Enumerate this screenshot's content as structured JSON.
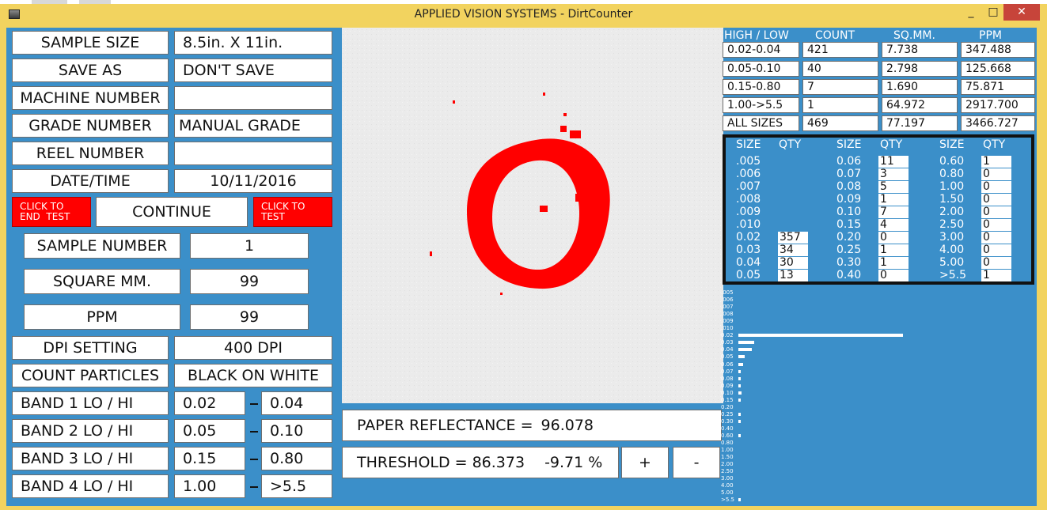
{
  "window": {
    "title": "APPLIED VISION SYSTEMS - DirtCounter",
    "minimize": "_",
    "maximize": "□",
    "close": "✕"
  },
  "icons": {
    "app": "app-icon"
  },
  "fields": {
    "sample_size": {
      "label": "SAMPLE SIZE",
      "value": "8.5in. X 11in."
    },
    "save_as": {
      "label": "SAVE AS",
      "value": "DON'T SAVE"
    },
    "machine_number": {
      "label": "MACHINE NUMBER",
      "value": ""
    },
    "grade_number": {
      "label": "GRADE NUMBER",
      "value": "MANUAL GRADE"
    },
    "reel_number": {
      "label": "REEL NUMBER",
      "value": ""
    },
    "date_time": {
      "label": "DATE/TIME",
      "value": "10/11/2016"
    }
  },
  "buttons": {
    "end_test": "CLICK TO\nEND  TEST",
    "continue": "CONTINUE",
    "test": "CLICK TO\nTEST"
  },
  "results": {
    "sample_number": {
      "label": "SAMPLE NUMBER",
      "value": "1"
    },
    "square_mm": {
      "label": "SQUARE MM.",
      "value": "99"
    },
    "ppm": {
      "label": "PPM",
      "value": "99"
    }
  },
  "settings": {
    "dpi": {
      "label": "DPI SETTING",
      "value": "400 DPI"
    },
    "count_particles": {
      "label": "COUNT PARTICLES",
      "value": "BLACK ON WHITE"
    }
  },
  "bands": [
    {
      "label": "BAND 1 LO / HI",
      "lo": "0.02",
      "hi": "0.04"
    },
    {
      "label": "BAND 2 LO / HI",
      "lo": "0.05",
      "hi": "0.10"
    },
    {
      "label": "BAND 3 LO / HI",
      "lo": "0.15",
      "hi": "0.80"
    },
    {
      "label": "BAND 4 LO / HI",
      "lo": "1.00",
      "hi": ">5.5"
    }
  ],
  "reflectance": {
    "label": "PAPER REFLECTANCE =",
    "value": "96.078"
  },
  "threshold": {
    "label": "THRESHOLD =",
    "value": "86.373",
    "percent": "-9.71 %",
    "plus": "+",
    "minus": "-"
  },
  "band_table": {
    "headers": [
      "HIGH  / LOW",
      "COUNT",
      "SQ.MM.",
      "PPM"
    ],
    "rows": [
      {
        "range": "0.02-0.04",
        "count": "421",
        "sqmm": "7.738",
        "ppm": "347.488"
      },
      {
        "range": "0.05-0.10",
        "count": "40",
        "sqmm": "2.798",
        "ppm": "125.668"
      },
      {
        "range": "0.15-0.80",
        "count": "7",
        "sqmm": "1.690",
        "ppm": "75.871"
      },
      {
        "range": "1.00->5.5",
        "count": "1",
        "sqmm": "64.972",
        "ppm": "2917.700"
      },
      {
        "range": "ALL SIZES",
        "count": "469",
        "sqmm": "77.197",
        "ppm": "3466.727"
      }
    ]
  },
  "size_table": {
    "headers": [
      "SIZE",
      "QTY"
    ],
    "col1": [
      {
        "size": ".005",
        "qty": ""
      },
      {
        "size": ".006",
        "qty": ""
      },
      {
        "size": ".007",
        "qty": ""
      },
      {
        "size": ".008",
        "qty": ""
      },
      {
        "size": ".009",
        "qty": ""
      },
      {
        "size": ".010",
        "qty": ""
      },
      {
        "size": "0.02",
        "qty": "357"
      },
      {
        "size": "0.03",
        "qty": "34"
      },
      {
        "size": "0.04",
        "qty": "30"
      },
      {
        "size": "0.05",
        "qty": "13"
      }
    ],
    "col2": [
      {
        "size": "0.06",
        "qty": "11"
      },
      {
        "size": "0.07",
        "qty": "3"
      },
      {
        "size": "0.08",
        "qty": "5"
      },
      {
        "size": "0.09",
        "qty": "1"
      },
      {
        "size": "0.10",
        "qty": "7"
      },
      {
        "size": "0.15",
        "qty": "4"
      },
      {
        "size": "0.20",
        "qty": "0"
      },
      {
        "size": "0.25",
        "qty": "1"
      },
      {
        "size": "0.30",
        "qty": "1"
      },
      {
        "size": "0.40",
        "qty": "0"
      }
    ],
    "col3": [
      {
        "size": "0.60",
        "qty": "1"
      },
      {
        "size": "0.80",
        "qty": "0"
      },
      {
        "size": "1.00",
        "qty": "0"
      },
      {
        "size": "1.50",
        "qty": "0"
      },
      {
        "size": "2.00",
        "qty": "0"
      },
      {
        "size": "2.50",
        "qty": "0"
      },
      {
        "size": "3.00",
        "qty": "0"
      },
      {
        "size": "4.00",
        "qty": "0"
      },
      {
        "size": "5.00",
        "qty": "0"
      },
      {
        "size": ">5.5",
        "qty": "1"
      }
    ]
  },
  "chart_data": {
    "type": "bar",
    "orientation": "horizontal",
    "categories": [
      ".005",
      ".006",
      ".007",
      ".008",
      ".009",
      ".010",
      "0.02",
      "0.03",
      "0.04",
      "0.05",
      "0.06",
      "0.07",
      "0.08",
      "0.09",
      "0.10",
      "0.15",
      "0.20",
      "0.25",
      "0.30",
      "0.40",
      "0.60",
      "0.80",
      "1.00",
      "1.50",
      "2.00",
      "2.50",
      "3.00",
      "4.00",
      "5.00",
      ">5.5"
    ],
    "values": [
      0,
      0,
      0,
      0,
      0,
      0,
      357,
      34,
      30,
      13,
      11,
      3,
      5,
      1,
      7,
      4,
      0,
      1,
      1,
      0,
      1,
      0,
      0,
      0,
      0,
      0,
      0,
      0,
      0,
      1
    ],
    "bar_color": "#ffffff"
  },
  "colors": {
    "background": "#3b8fc9",
    "accent_red": "#ff0000",
    "frame": "#f2d35f",
    "close": "#c7443a"
  }
}
